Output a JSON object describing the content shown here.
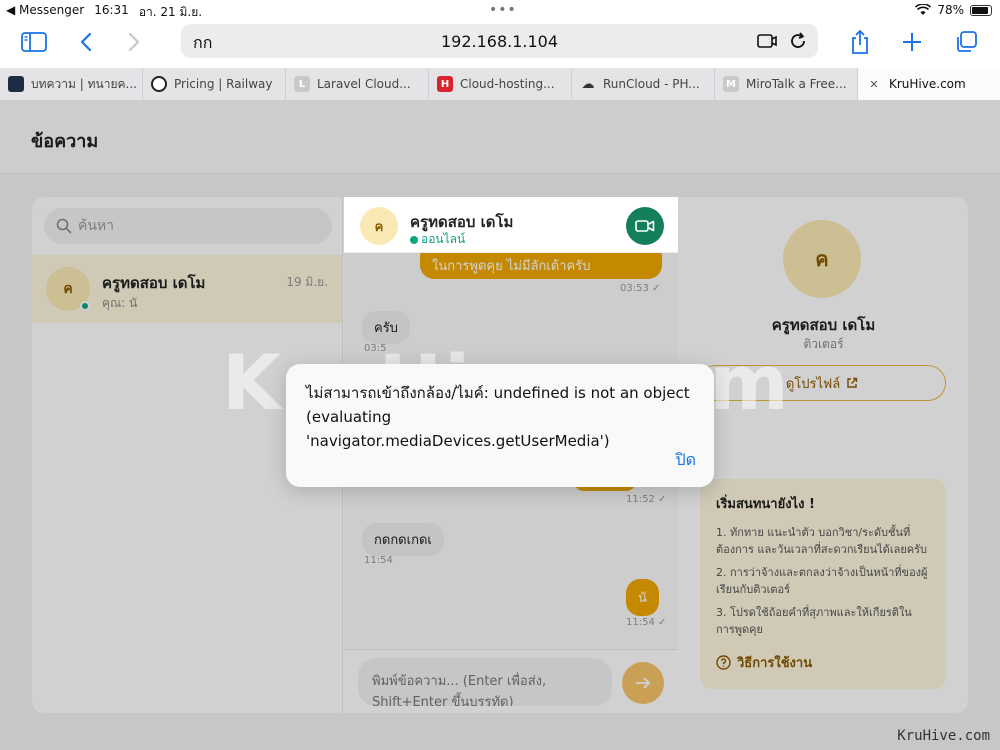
{
  "status_bar": {
    "back_app": "◀ Messenger",
    "time": "16:31",
    "date": "อา. 21 มิ.ย.",
    "battery_percent": "78%",
    "battery_level": 0.78
  },
  "browser": {
    "reader_label": "กก",
    "url": "192.168.1.104"
  },
  "tabs": [
    {
      "title": "บทความ | ทนายค...",
      "fav_color": "#1f2a44",
      "fav_text": ""
    },
    {
      "title": "Pricing | Railway",
      "fav_color": "#222222",
      "fav_text": ""
    },
    {
      "title": "Laravel Cloud...",
      "fav_color": "#c9c9cc",
      "fav_text": "L"
    },
    {
      "title": "Cloud-hosting...",
      "fav_color": "#d9232e",
      "fav_text": "H"
    },
    {
      "title": "RunCloud - PH...",
      "fav_color": "#ffffff",
      "fav_text": ""
    },
    {
      "title": "MiroTalk a Free...",
      "fav_color": "#c9c9cc",
      "fav_text": "M"
    },
    {
      "title": "KruHive.com",
      "fav_color": "#ffffff",
      "fav_text": "✕"
    }
  ],
  "page": {
    "title": "ข้อความ"
  },
  "search": {
    "placeholder": "ค้นหา"
  },
  "conversation": {
    "avatar_letter": "ค",
    "name": "ครูทดสอบ เดโม",
    "preview": "คุณ: นั",
    "date": "19 มิ.ย."
  },
  "chat": {
    "header_name": "ครูทดสอบ เดโม",
    "header_status": "ออนไลน์",
    "avatar_letter": "ค",
    "messages": [
      {
        "text": "ในการพูดคุย ไม่มีลักเต้าครับ",
        "time": "03:53 ✓",
        "dir": "out"
      },
      {
        "text": "ครับ",
        "time": "03:5",
        "dir": "in"
      },
      {
        "text": "",
        "time": "11:52 ✓",
        "dir": "out"
      },
      {
        "text": "กดกดเกดเ",
        "time": "11:54",
        "dir": "in"
      },
      {
        "text": "นั",
        "time": "11:54 ✓",
        "dir": "out"
      }
    ],
    "composer_placeholder": "พิมพ์ข้อความ... (Enter เพื่อส่ง, Shift+Enter ขึ้นบรรทัด)"
  },
  "profile": {
    "avatar_letter": "ค",
    "name": "ครูทดสอบ เดโม",
    "role": "ติวเตอร์",
    "button_label": "ดูโปรไฟล์"
  },
  "tips": {
    "title": "เริ่มสนทนายังไง !",
    "items": [
      "1. ทักทาย แนะนำตัว บอกวิชา/ระดับชั้นที่ต้องการ และวันเวลาที่สะดวกเรียนได้เลยครับ",
      "2. การว่าจ้างและตกลงว่าจ้างเป็นหน้าที่ของผู้เรียนกับติวเตอร์",
      "3. โปรดใช้ถ้อยคำที่สุภาพและให้เกียรติในการพูดคุย"
    ],
    "link_label": "วิธีการใช้งาน"
  },
  "alert": {
    "message": "ไม่สามารถเข้าถึงกล้อง/ไมค์: undefined is not an object (evaluating 'navigator.mediaDevices.getUserMedia')",
    "close_label": "ปิด"
  },
  "watermark": {
    "center_text": "KruHive.com",
    "corner_text": "KruHive.com"
  },
  "colors": {
    "accent": "#f0a800",
    "online": "#10a37f",
    "video": "#14805a",
    "link": "#1a73e8"
  }
}
